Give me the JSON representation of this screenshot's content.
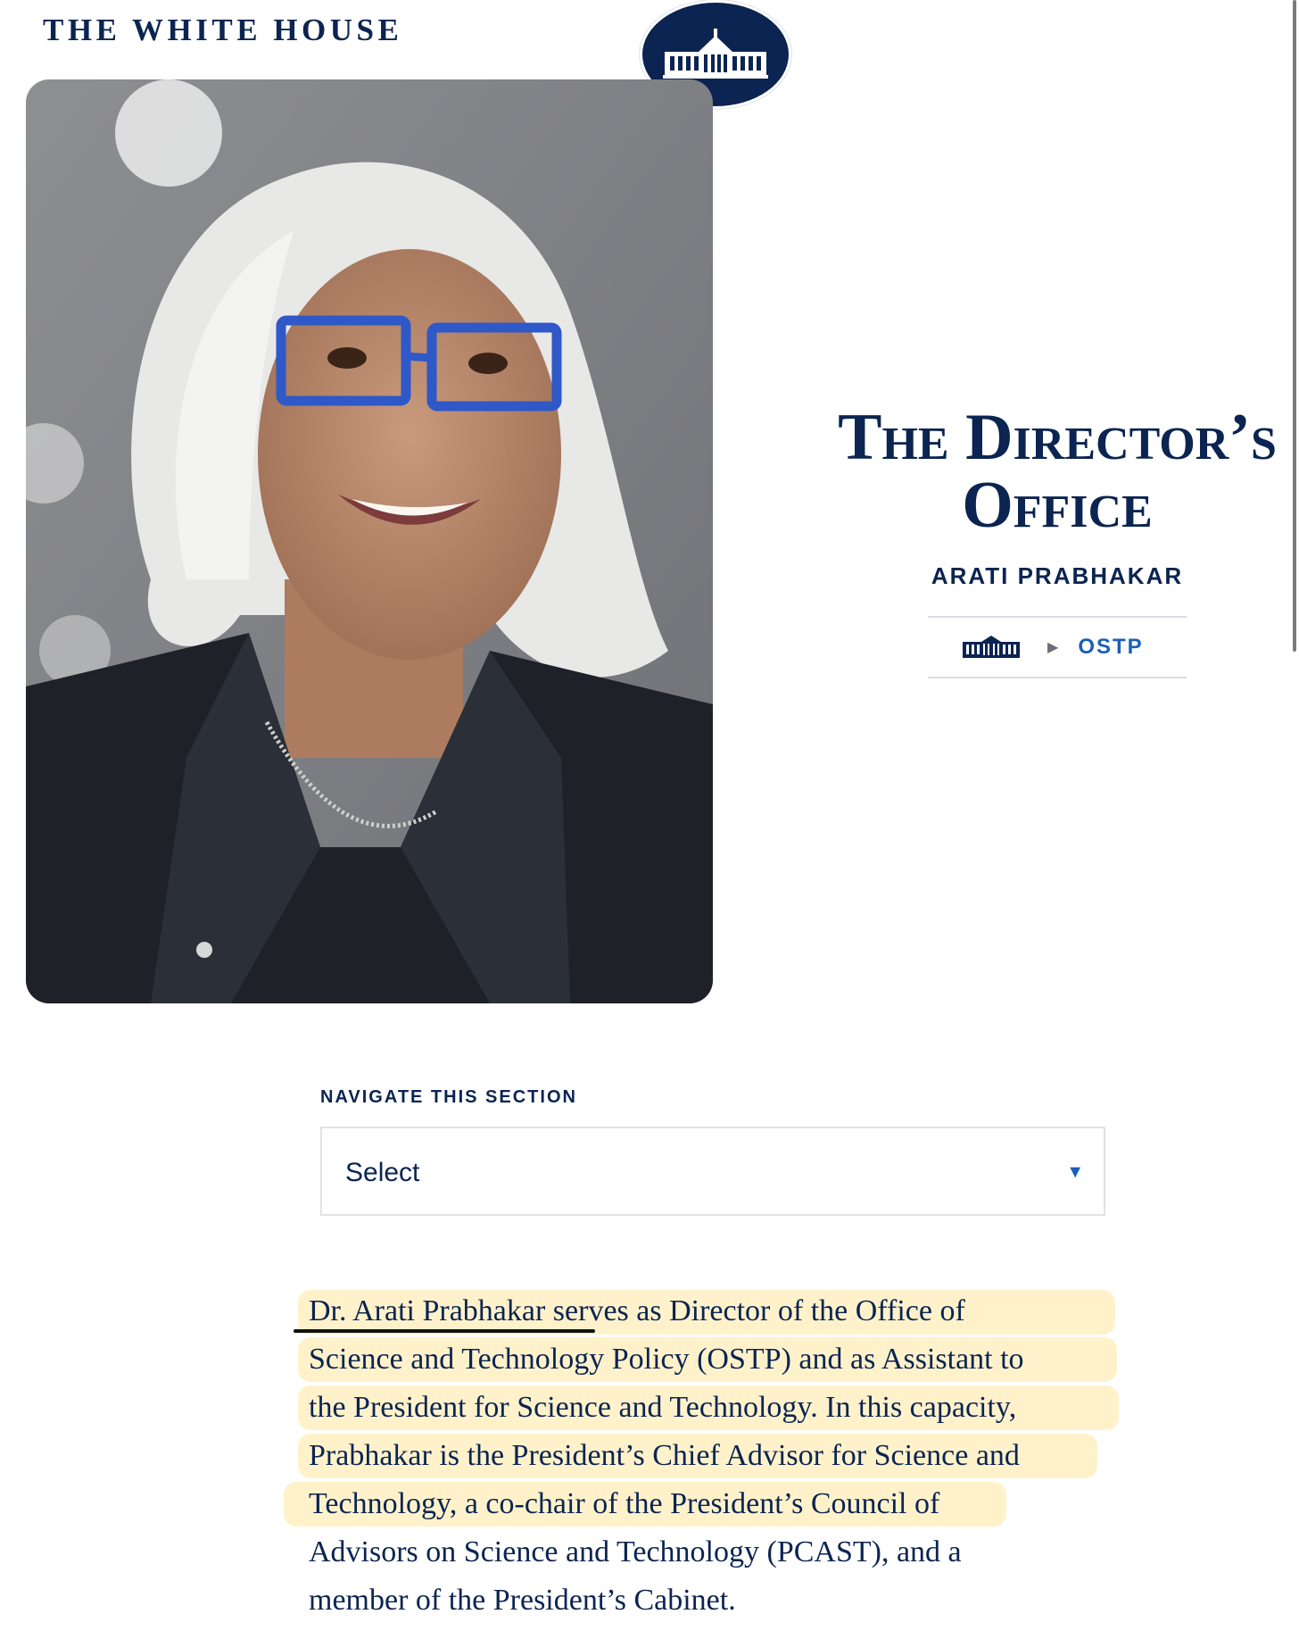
{
  "header": {
    "site_title": "THE WHITE HOUSE",
    "logo_icon": "white-house-seal-icon"
  },
  "hero": {
    "image_alt": "Portrait of Arati Prabhakar",
    "title_line1": "The Director’s",
    "title_line2": "Office",
    "subtitle": "ARATI PRABHAKAR",
    "breadcrumb": {
      "home_icon": "white-house-icon",
      "separator_icon": "caret-right-icon",
      "current": "OSTP"
    }
  },
  "section_nav": {
    "label": "NAVIGATE THIS SECTION",
    "select_value": "Select"
  },
  "bio": {
    "lines": [
      "Dr. Arati Prabhakar serves as Director of the Office of",
      "Science and Technology Policy (OSTP) and as Assistant to",
      "the President for Science and Technology. In this capacity,",
      "Prabhakar is the President’s Chief Advisor for Science and",
      "Technology, a co-chair of the President’s Council of",
      "Advisors on Science and Technology (PCAST), and a",
      "member of the President’s Cabinet."
    ]
  },
  "colors": {
    "brand_navy": "#0b2451",
    "link_blue": "#1c5fb8",
    "highlight": "#ffe8a0"
  }
}
